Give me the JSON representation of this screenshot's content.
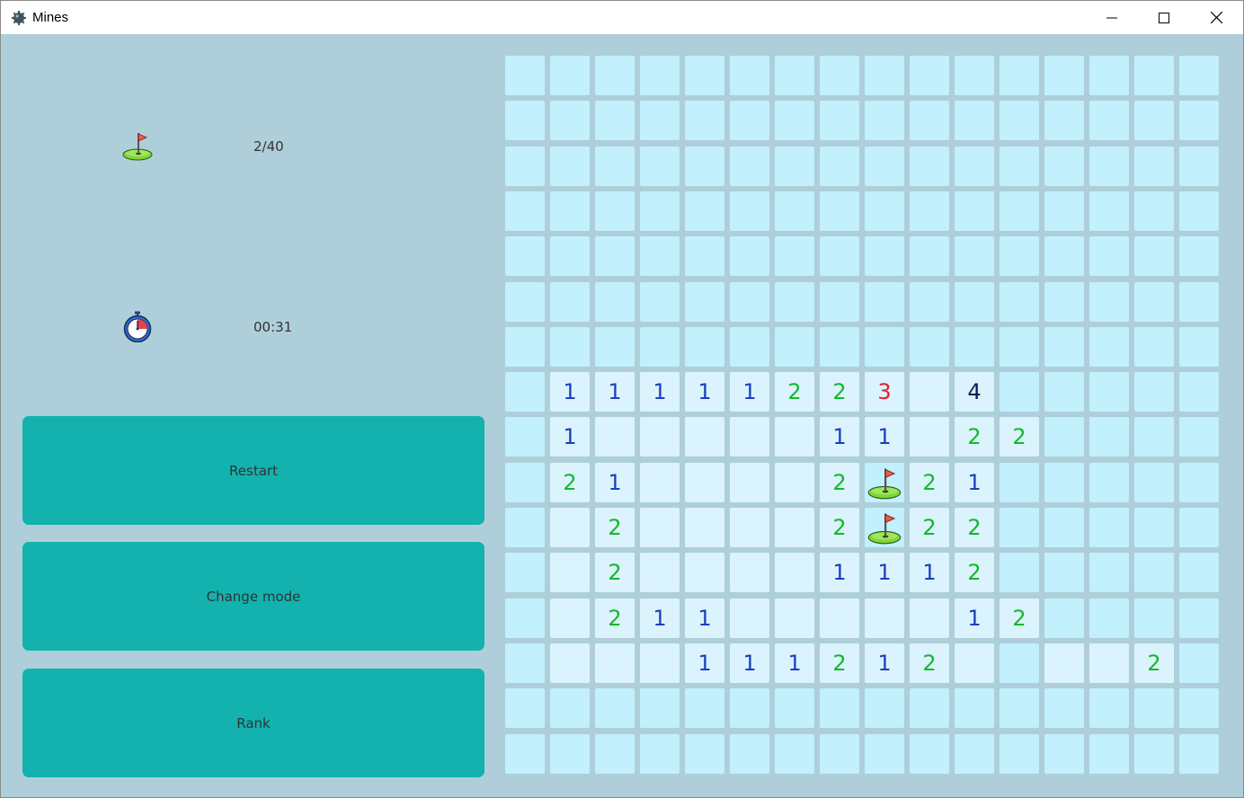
{
  "window": {
    "title": "Mines",
    "controls": {
      "minimize": "minimize-icon",
      "maximize": "maximize-icon",
      "close": "close-icon"
    }
  },
  "stats": {
    "flags": {
      "icon": "flag-icon",
      "value": "2/40"
    },
    "timer": {
      "icon": "stopwatch-icon",
      "value": "00:31"
    }
  },
  "actions": {
    "restart": "Restart",
    "change_mode": "Change mode",
    "rank": "Rank"
  },
  "board": {
    "rows": 16,
    "cols": 16,
    "number_colors": {
      "1": "#1a3fc0",
      "2": "#12b82b",
      "3": "#e0202a",
      "4": "#0b1a5a"
    },
    "grid": [
      "################",
      "################",
      "################",
      "################",
      "################",
      "################",
      "################",
      "#11111223 4#####",
      "#1     11 22#####",
      "#21    2F21#####",
      "# 2    2F22#####",
      "# 2    1112#####",
      "# 211     12#####",
      "#   111212 #  2##",
      "################",
      "################"
    ]
  },
  "colors": {
    "window_bg": "#aecfda",
    "button_bg": "#13b2ae",
    "cell_covered": "#c2f0fc",
    "cell_open": "#dbf3fc"
  }
}
